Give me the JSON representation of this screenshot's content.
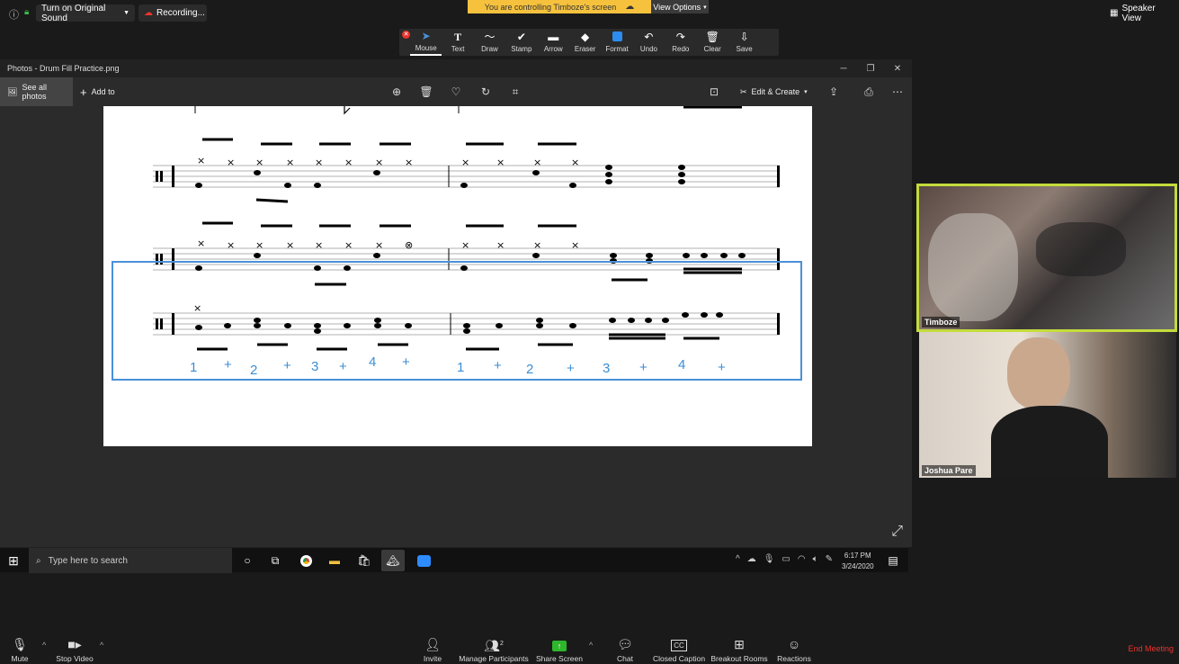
{
  "zoom_top": {
    "original_sound": "Turn on Original Sound",
    "recording": "Recording...",
    "control_banner": "You are controlling Timboze's screen",
    "view_options": "View Options",
    "speaker_view": "Speaker View"
  },
  "annotation_tools": [
    {
      "label": "Mouse",
      "icon": "pointer-icon"
    },
    {
      "label": "Text",
      "icon": "text-icon"
    },
    {
      "label": "Draw",
      "icon": "draw-icon"
    },
    {
      "label": "Stamp",
      "icon": "stamp-icon"
    },
    {
      "label": "Arrow",
      "icon": "arrow-icon"
    },
    {
      "label": "Eraser",
      "icon": "eraser-icon"
    },
    {
      "label": "Format",
      "icon": "format-icon"
    },
    {
      "label": "Undo",
      "icon": "undo-icon"
    },
    {
      "label": "Redo",
      "icon": "redo-icon"
    },
    {
      "label": "Clear",
      "icon": "trash-icon"
    },
    {
      "label": "Save",
      "icon": "save-icon"
    }
  ],
  "photos": {
    "title": "Photos - Drum Fill Practice.png",
    "see_all": "See all photos",
    "add_to": "Add to",
    "edit_create": "Edit & Create"
  },
  "counts": {
    "measure1": [
      "1",
      "+",
      "2",
      "+",
      "3",
      "+",
      "4",
      "+"
    ],
    "measure2": [
      "1",
      "+",
      "2",
      "+",
      "3",
      "+",
      "4",
      "+"
    ]
  },
  "taskbar": {
    "search_placeholder": "Type here to search",
    "time": "6:17 PM",
    "date": "3/24/2020"
  },
  "participants": {
    "active": "Timboze",
    "self": "Joshua Pare"
  },
  "bottom_bar": {
    "mute": "Mute",
    "stop_video": "Stop Video",
    "invite": "Invite",
    "manage_participants": "Manage Participants",
    "participant_count": "2",
    "share_screen": "Share Screen",
    "chat": "Chat",
    "closed_caption": "Closed Caption",
    "breakout_rooms": "Breakout Rooms",
    "reactions": "Reactions",
    "end_meeting": "End Meeting"
  },
  "colors": {
    "banner": "#f6c23e",
    "active_speaker_border": "#c4dc3c",
    "selection": "#4a90d9",
    "end_meeting": "#e8342e",
    "share_green": "#2eb62c"
  }
}
